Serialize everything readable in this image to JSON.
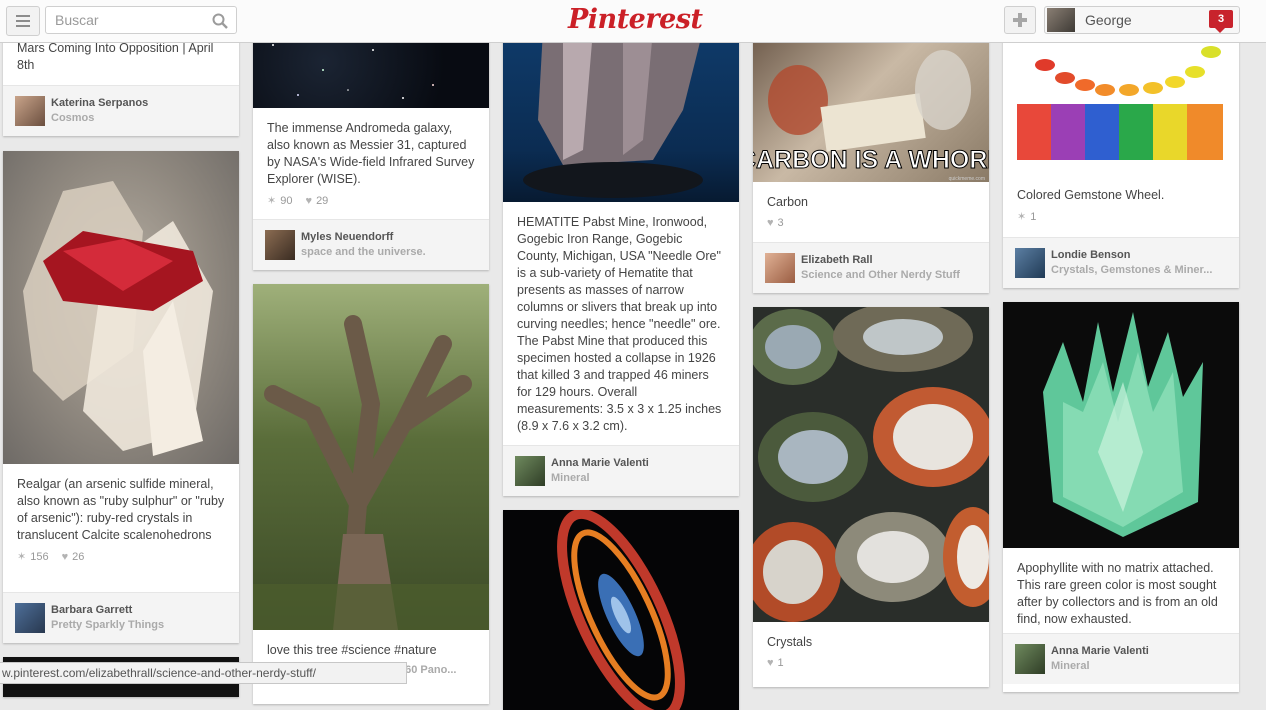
{
  "header": {
    "search_placeholder": "Buscar",
    "logo": "Pinterest",
    "user_name": "George",
    "notification_count": "3"
  },
  "pins": [
    {
      "id": "c1a",
      "description": "Mars Coming Into Opposition | April 8th",
      "user": "Katerina Serpanos",
      "board": "Cosmos"
    },
    {
      "id": "c1b",
      "description": "Realgar (an arsenic sulfide mineral, also known as \"ruby sulphur\" or \"ruby of arsenic\"): ruby-red crystals in translucent Calcite scalenohedrons",
      "repins": "156",
      "likes": "26",
      "user": "Barbara Garrett",
      "board": "Pretty Sparkly Things"
    },
    {
      "id": "c2a",
      "description": "The immense Andromeda galaxy, also known as Messier 31, captured by NASA's Wide-field Infrared Survey Explorer (WISE).",
      "repins": "90",
      "likes": "29",
      "user": "Myles Neuendorff",
      "board": "space and the universe."
    },
    {
      "id": "c2b",
      "description": "love this tree #science #nature",
      "board": "360 Pano..."
    },
    {
      "id": "c3a",
      "description": "HEMATITE Pabst Mine, Ironwood, Gogebic Iron Range, Gogebic County, Michigan, USA \"Needle Ore\" is a sub-variety of Hematite that presents as masses of narrow columns or slivers that break up into curving needles; hence \"needle\" ore. The Pabst Mine that produced this specimen hosted a collapse in 1926 that killed 3 and trapped 46 miners for 129 hours. Overall measurements: 3.5 x 3 x 1.25 inches (8.9 x 7.6 x 3.2 cm).",
      "user": "Anna Marie Valenti",
      "board": "Mineral"
    },
    {
      "id": "c4a",
      "image_caption": "CARBON IS A WHORE",
      "watermark": "quickmeme.com",
      "description": "Carbon",
      "likes": "3",
      "user": "Elizabeth Rall",
      "board": "Science and Other Nerdy Stuff"
    },
    {
      "id": "c4b",
      "description": "Crystals",
      "likes": "1"
    },
    {
      "id": "c5a",
      "description": "Colored Gemstone Wheel.",
      "repins": "1",
      "user": "Londie Benson",
      "board": "Crystals, Gemstones & Miner..."
    },
    {
      "id": "c5b",
      "description": "Apophyllite with no matrix attached. This rare green color is most sought after by collectors and is from an old find, now exhausted.",
      "user": "Anna Marie Valenti",
      "board": "Mineral"
    }
  ],
  "status_bar": "w.pinterest.com/elizabethrall/science-and-other-nerdy-stuff/",
  "colors": {
    "brand": "#cb2027",
    "background": "#e9e9e9",
    "badge": "#c8232c"
  }
}
